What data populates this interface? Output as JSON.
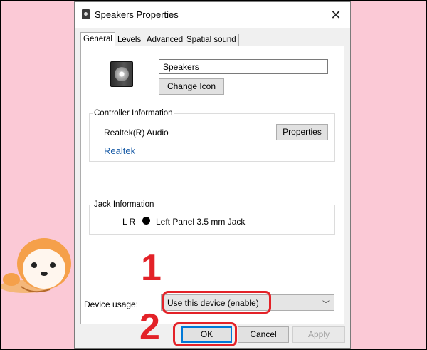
{
  "dialog": {
    "title": "Speakers Properties",
    "tabs": [
      {
        "label": "General",
        "active": true
      },
      {
        "label": "Levels",
        "active": false
      },
      {
        "label": "Advanced",
        "active": false
      },
      {
        "label": "Spatial sound",
        "active": false
      }
    ],
    "general": {
      "device_name": "Speakers",
      "change_icon_label": "Change Icon",
      "controller": {
        "legend": "Controller Information",
        "name": "Realtek(R) Audio",
        "properties_label": "Properties",
        "link": "Realtek"
      },
      "jack": {
        "legend": "Jack Information",
        "channels": "L R",
        "dot_color": "#000000",
        "description": "Left Panel 3.5 mm Jack"
      },
      "device_usage": {
        "label": "Device usage:",
        "value": "Use this device (enable)"
      }
    },
    "buttons": {
      "ok": "OK",
      "cancel": "Cancel",
      "apply": "Apply"
    }
  },
  "annotations": {
    "step1": "1",
    "step2": "2",
    "color": "#e32228"
  },
  "icons": [
    "speaker-icon",
    "close-icon",
    "chevron-down-icon",
    "mascot-icon"
  ]
}
